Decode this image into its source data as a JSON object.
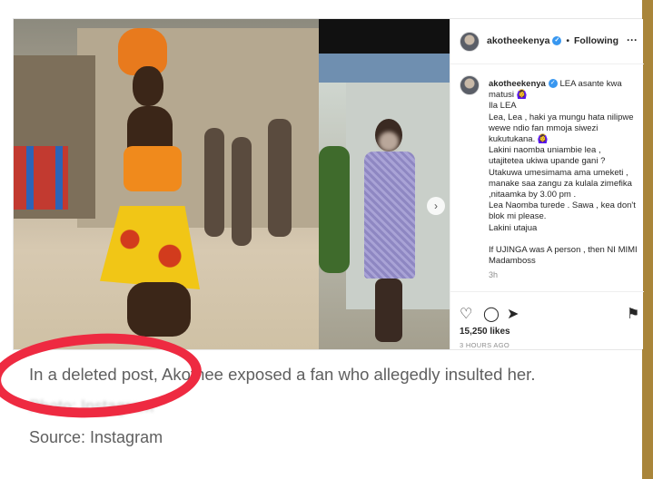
{
  "post": {
    "header": {
      "username": "akotheekenya",
      "separator": "•",
      "follow_status": "Following",
      "more_label": "···"
    },
    "caption": {
      "username": "akotheekenya",
      "first_line": " LEA asante kwa matusi 🙆‍♀️",
      "body": "Ila LEA\nLea, Lea , haki ya mungu hata nilipwe wewe ndio fan mmoja siwezi kukutukana. 🙆‍♀️\nLakini naomba uniambie lea ,\nutajitetea ukiwa upande gani ?\nUtakuwa umesimama ama umeketi ,\nmanake saa zangu za kulala zimefika ,nitaamka by 3.00 pm .\nLea Naomba turede . Sawa , kea don't blok mi please.\nLakini utajua\n\nIf UJINGA was A person , then NI MIMI Madamboss",
      "time_ago": "3h"
    },
    "carousel_next": "›",
    "likes": "15,250 likes",
    "posted": "3 HOURS AGO",
    "icons": {
      "like": "heart-icon",
      "comment": "comment-icon",
      "share": "send-icon",
      "save": "bookmark-icon"
    }
  },
  "article": {
    "line1": "In a deleted post, Akothee exposed a fan who allegedly insulted her.",
    "line2": "Photo: Instagram",
    "source": "Source: Instagram"
  },
  "colors": {
    "frame": "#a9853a",
    "annotation": "#ee2a41",
    "verified": "#3897f0"
  }
}
